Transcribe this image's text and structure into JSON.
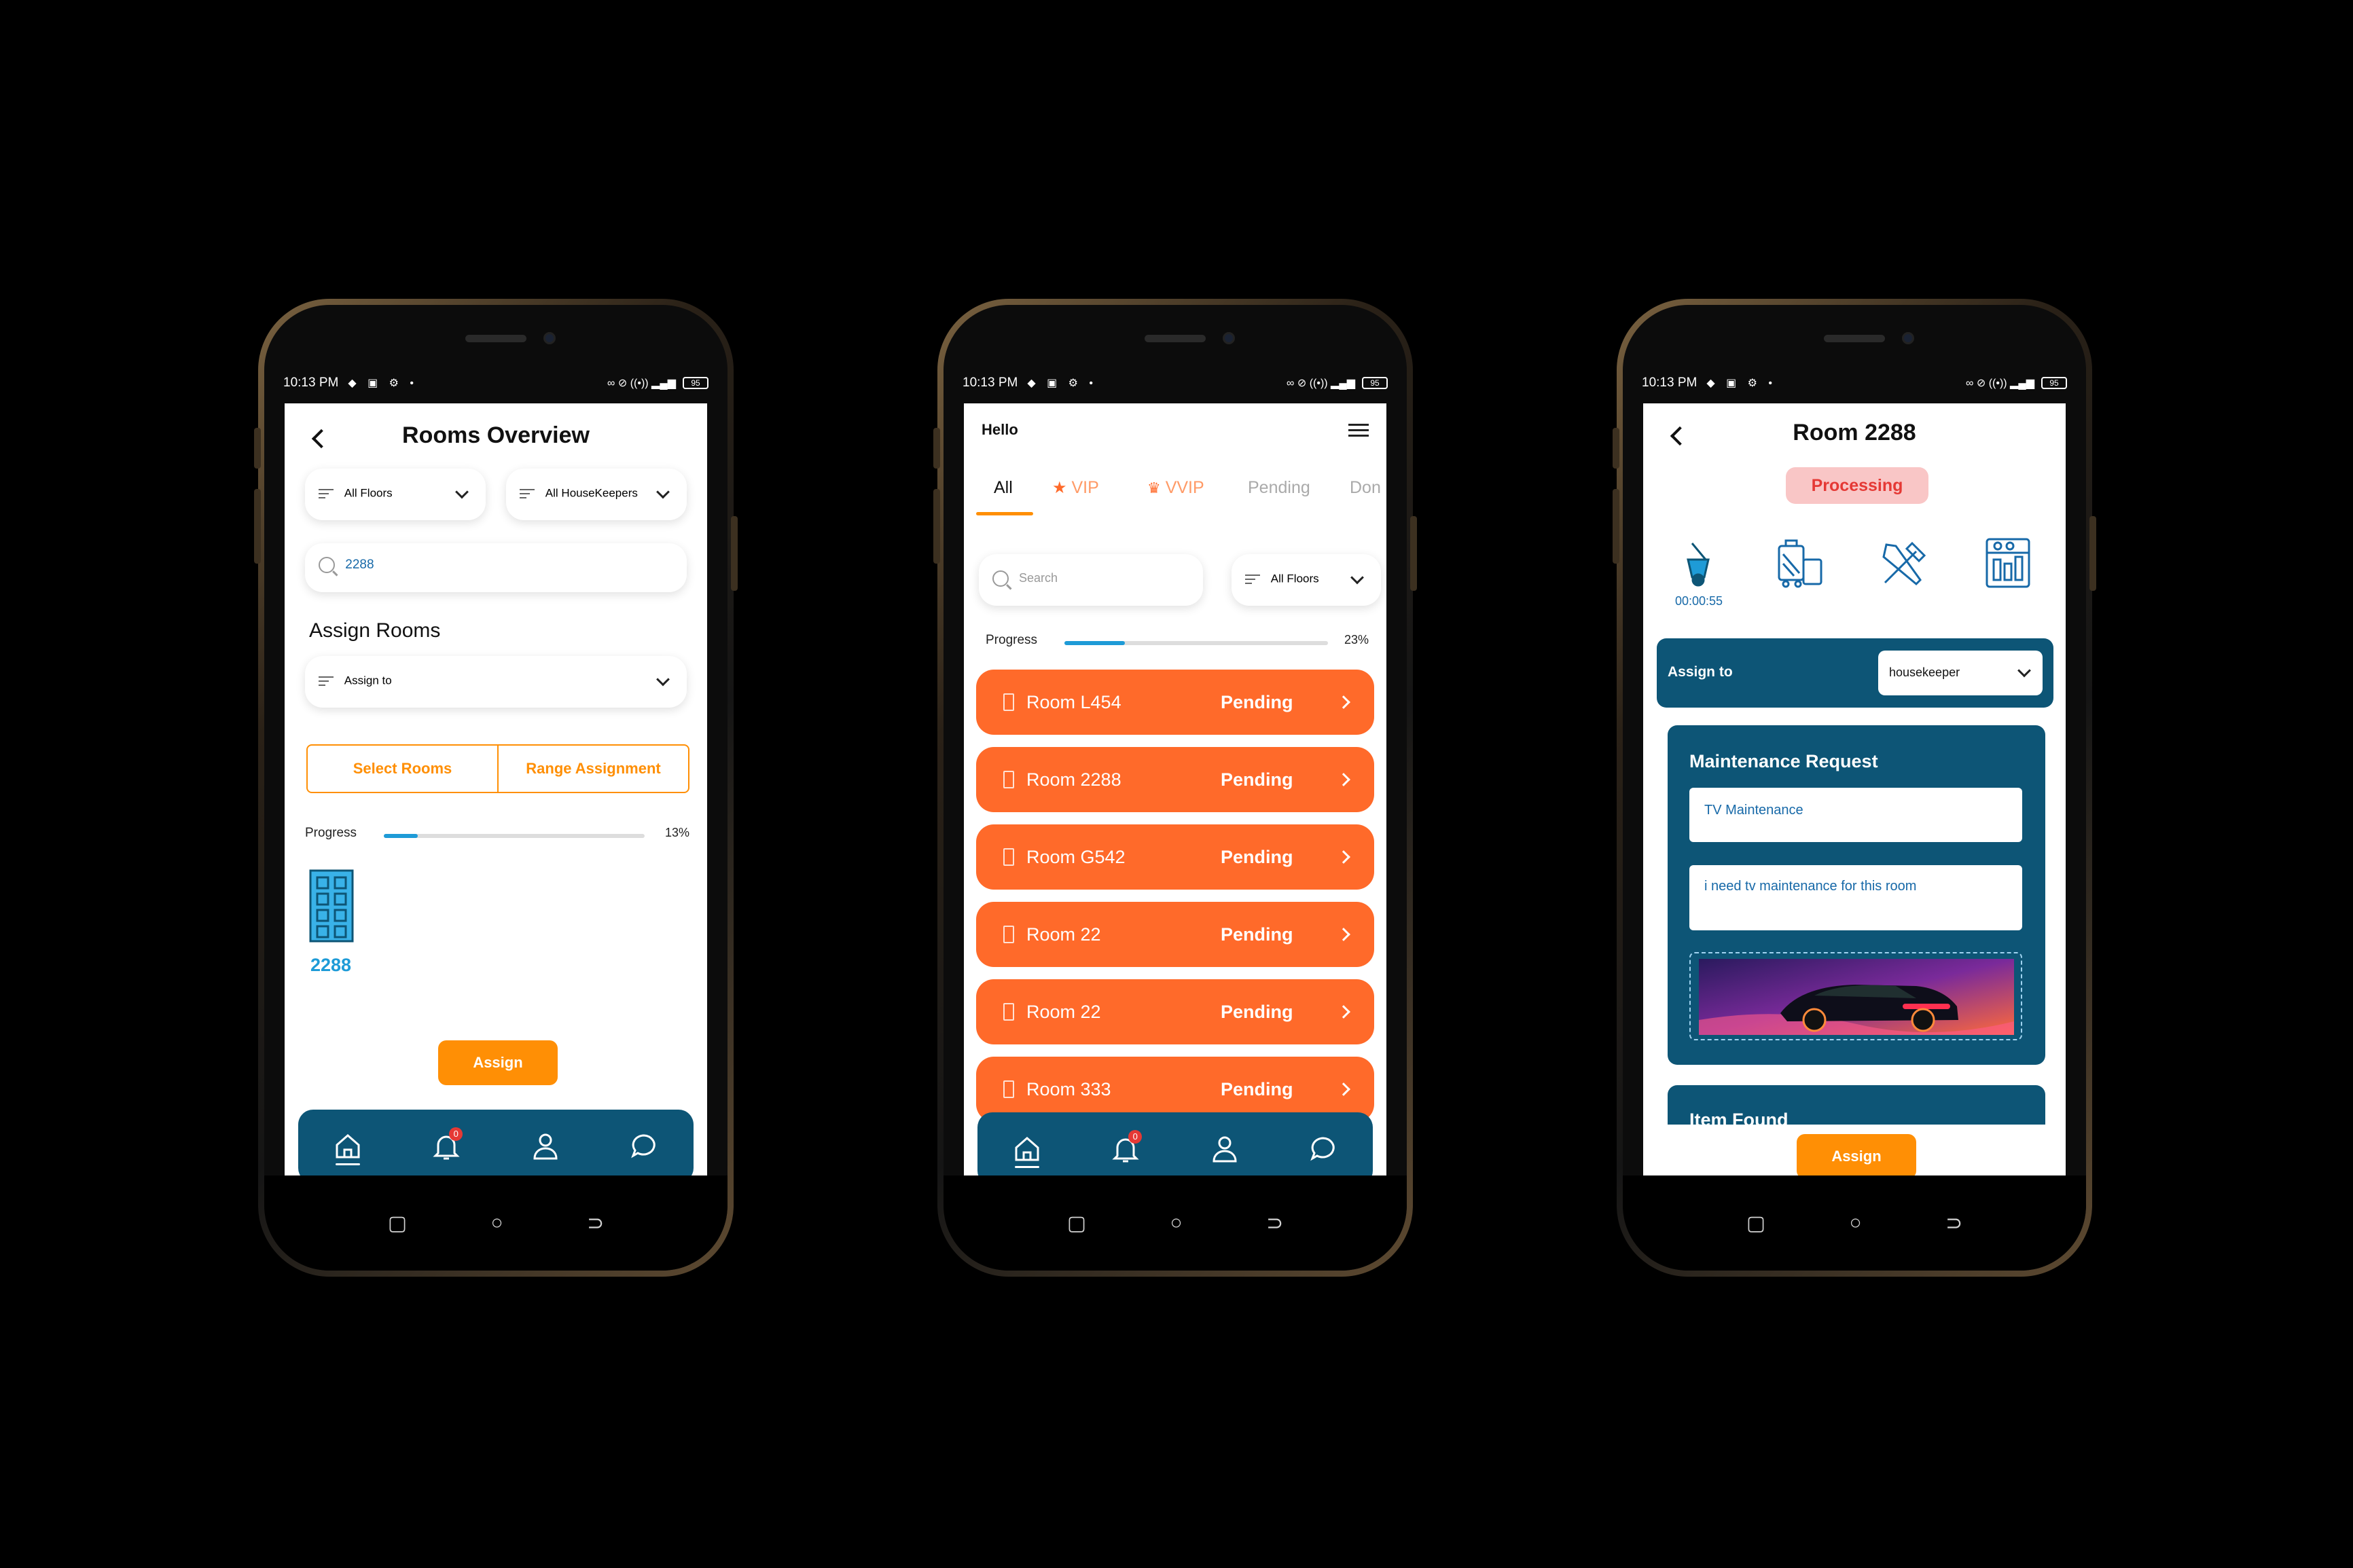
{
  "status_bar": {
    "time": "10:13 PM",
    "battery": "95"
  },
  "screen1": {
    "title": "Rooms Overview",
    "floor_filter": "All Floors",
    "housekeeper_filter": "All HouseKeepers",
    "search_value": "2288",
    "section_title": "Assign Rooms",
    "assign_to_placeholder": "Assign to",
    "select_rooms_label": "Select Rooms",
    "range_assignment_label": "Range Assignment",
    "progress_label": "Progress",
    "progress_value": 0.13,
    "progress_text": "13%",
    "room_number": "2288",
    "assign_button": "Assign",
    "notification_count": "0"
  },
  "screen2": {
    "greeting": "Hello",
    "tabs": [
      {
        "label": "All",
        "icon": ""
      },
      {
        "label": "VIP",
        "icon": "star-icon"
      },
      {
        "label": "VVIP",
        "icon": "crown-icon"
      },
      {
        "label": "Pending",
        "icon": ""
      },
      {
        "label": "Don",
        "icon": ""
      }
    ],
    "search_placeholder": "Search",
    "floor_filter": "All Floors",
    "progress_label": "Progress",
    "progress_value": 0.23,
    "progress_text": "23%",
    "rooms": [
      {
        "name": "Room L454",
        "status": "Pending"
      },
      {
        "name": "Room 2288",
        "status": "Pending"
      },
      {
        "name": "Room G542",
        "status": "Pending"
      },
      {
        "name": "Room 22",
        "status": "Pending"
      },
      {
        "name": "Room 22",
        "status": "Pending"
      },
      {
        "name": "Room 333",
        "status": "Pending"
      }
    ],
    "notification_count": "0"
  },
  "screen3": {
    "title": "Room 2288",
    "status": "Processing",
    "timer": "00:00:55",
    "service_icons": [
      "cleaning-icon",
      "luggage-icon",
      "tools-icon",
      "minibar-icon"
    ],
    "assign_to_label": "Assign to",
    "assign_to_value": "housekeeper",
    "maintenance_title": "Maintenance Request",
    "maintenance_subject": "TV Maintenance",
    "maintenance_description": "i need tv maintenance for this room",
    "item_found_title": "Item Found",
    "assign_button": "Assign"
  },
  "colors": {
    "orange": "#ff6a2a",
    "accent_orange": "#ff8f05",
    "navy": "#0d5576",
    "blue": "#1e9bd7",
    "processing_bg": "#f9c6c6",
    "processing_text": "#e53935"
  }
}
